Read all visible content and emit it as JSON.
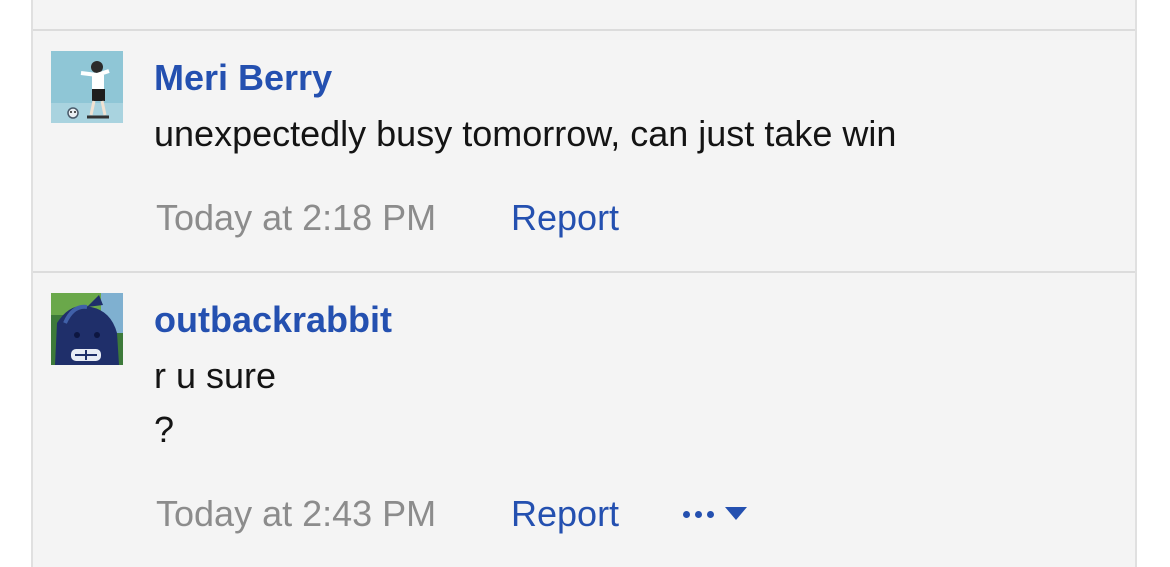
{
  "comments": [
    {
      "author": "Meri Berry",
      "avatar_icon": "user-avatar-figure",
      "lines": [
        "unexpectedly busy tomorrow, can just take win"
      ],
      "time": "Today at 2:18 PM",
      "report_label": "Report"
    },
    {
      "author": "outbackrabbit",
      "avatar_icon": "user-avatar-creature",
      "lines": [
        "r u sure",
        "?"
      ],
      "time": "Today at 2:43 PM",
      "report_label": "Report",
      "more_menu_icon": "more-options-dropdown"
    }
  ],
  "colors": {
    "link": "#2450b0",
    "text": "#141414",
    "muted": "#8c8c8c",
    "background": "#f4f4f4",
    "divider": "#dcdcdc"
  }
}
